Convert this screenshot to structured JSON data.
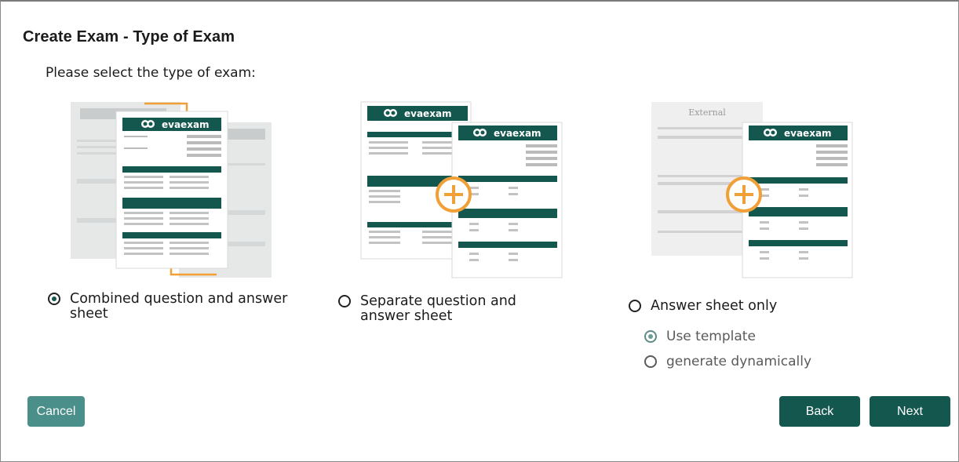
{
  "header": {
    "title": "Create Exam - Type of Exam",
    "prompt": "Please select the type of exam:"
  },
  "brand": {
    "name": "evaexam",
    "primary_color": "#14574f",
    "accent_color": "#f0a037",
    "secondary_button_color": "#4a8f89"
  },
  "options": [
    {
      "label": "Combined question and answer sheet",
      "line1": "Combined question and answer",
      "line2": "sheet",
      "selected": true
    },
    {
      "label": "Separate question and answer sheet",
      "line1": "Separate question and",
      "line2": "answer sheet",
      "selected": false
    },
    {
      "label": "Answer sheet only",
      "selected": false,
      "suboptions": [
        {
          "label": "Use template",
          "selected": true
        },
        {
          "label": "generate dynamically",
          "selected": false
        }
      ]
    }
  ],
  "illustrations": {
    "external_label": "External",
    "icons": [
      "exam-document-icon",
      "plus-circle-icon"
    ]
  },
  "buttons": {
    "cancel": "Cancel",
    "back": "Back",
    "next": "Next"
  }
}
